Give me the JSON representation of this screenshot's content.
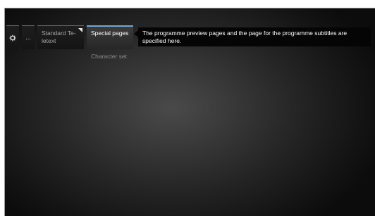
{
  "menu": {
    "settings_icon": "gear-icon",
    "more_label": "...",
    "standard_teletext_label": "Standard Te-\nletext",
    "special_pages_label": "Special pages",
    "character_set_label": "Character set"
  },
  "description": {
    "text": "The programme preview pages and the page for the programme subtitles are specified here."
  },
  "colors": {
    "accent": "#6ea6d8",
    "background": "#1a1a1a",
    "description_bg": "#050505"
  }
}
